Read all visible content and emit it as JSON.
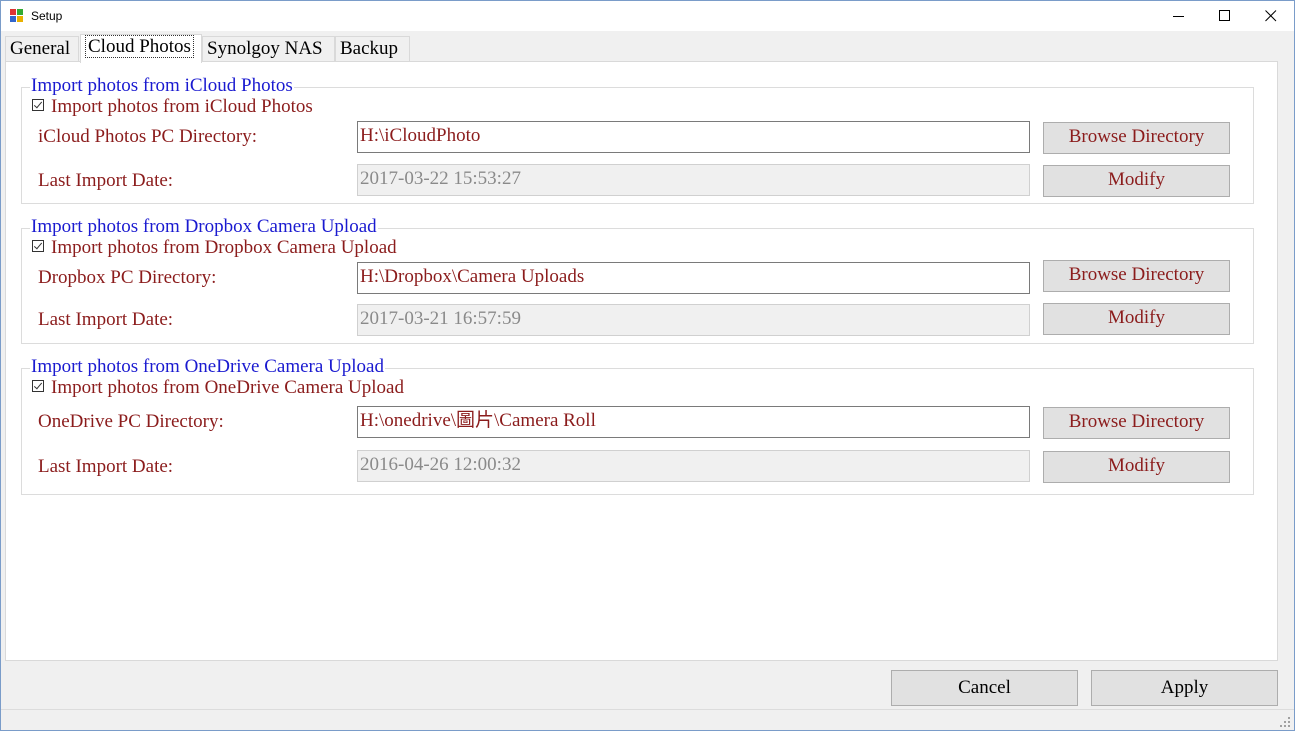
{
  "window": {
    "title": "Setup",
    "colors": {
      "accent_blue": "#1a1ad0",
      "label_red": "#8b1c1c"
    }
  },
  "tabs": [
    {
      "label": "General",
      "active": false
    },
    {
      "label": "Cloud Photos",
      "active": true
    },
    {
      "label": "Synolgoy NAS",
      "active": false
    },
    {
      "label": "Backup",
      "active": false
    }
  ],
  "icloud": {
    "legend": "Import photos from iCloud Photos",
    "checkbox_label": "Import photos from iCloud Photos",
    "checked": true,
    "dir_label": "iCloud Photos PC Directory:",
    "dir_value": "H:\\iCloudPhoto",
    "date_label": "Last Import Date:",
    "date_value": "2017-03-22 15:53:27",
    "browse_label": "Browse Directory",
    "modify_label": "Modify"
  },
  "dropbox": {
    "legend": "Import photos from Dropbox Camera Upload",
    "checkbox_label": "Import photos from Dropbox Camera Upload",
    "checked": true,
    "dir_label": "Dropbox PC Directory:",
    "dir_value": "H:\\Dropbox\\Camera Uploads",
    "date_label": "Last Import Date:",
    "date_value": "2017-03-21 16:57:59",
    "browse_label": "Browse Directory",
    "modify_label": "Modify"
  },
  "onedrive": {
    "legend": "Import photos from OneDrive Camera Upload",
    "checkbox_label": "Import photos from OneDrive Camera Upload",
    "checked": true,
    "dir_label": "OneDrive PC Directory:",
    "dir_value": "H:\\onedrive\\圖片\\Camera Roll",
    "date_label": "Last Import Date:",
    "date_value": "2016-04-26 12:00:32",
    "browse_label": "Browse Directory",
    "modify_label": "Modify"
  },
  "footer": {
    "cancel_label": "Cancel",
    "apply_label": "Apply"
  }
}
